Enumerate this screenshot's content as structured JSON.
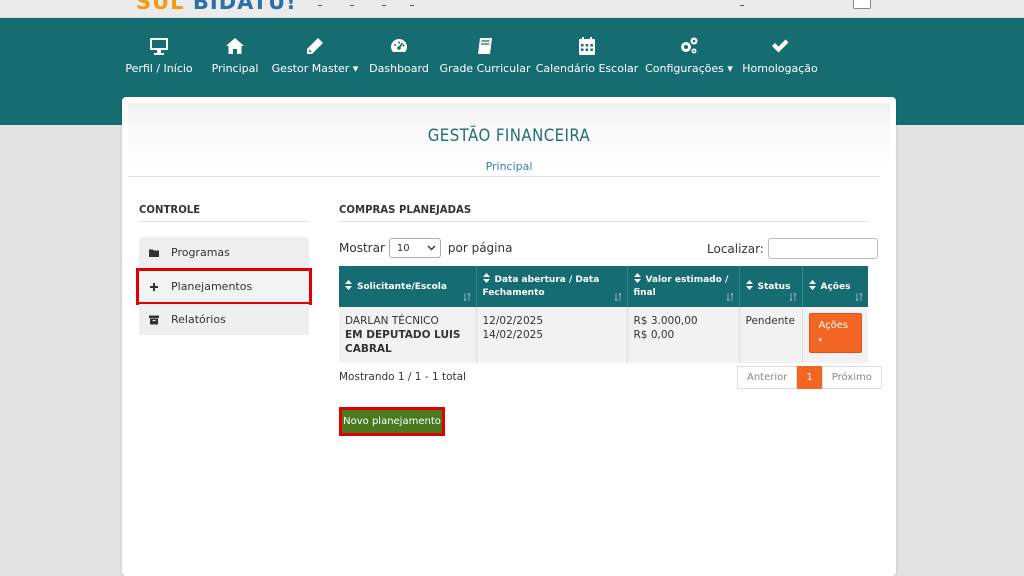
{
  "topbar": {
    "logo_text_a": "SUL",
    "logo_text_b": "BIDATU!"
  },
  "colors": {
    "primary_teal": "#156d72",
    "accent_orange": "#f26522",
    "highlight_red": "#e00000",
    "action_green": "#4a7a1f"
  },
  "nav": {
    "items": [
      {
        "label": "Perfil / Início",
        "icon": "monitor-icon"
      },
      {
        "label": "Principal",
        "icon": "home-icon"
      },
      {
        "label": "Gestor Master",
        "icon": "pencil-icon",
        "dropdown": true
      },
      {
        "label": "Dashboard",
        "icon": "gauge-icon"
      },
      {
        "label": "Grade Curricular",
        "icon": "book-icon"
      },
      {
        "label": "Calendário Escolar",
        "icon": "calendar-icon"
      },
      {
        "label": "Configurações",
        "icon": "gears-icon",
        "dropdown": true
      },
      {
        "label": "Homologação",
        "icon": "check-icon"
      }
    ]
  },
  "header": {
    "title": "GESTÃO FINANCEIRA",
    "breadcrumb": "Principal"
  },
  "sidebar": {
    "title": "CONTROLE",
    "items": [
      {
        "label": "Programas",
        "icon": "folder-icon"
      },
      {
        "label": "Planejamentos",
        "icon": "plus-icon",
        "active": true
      },
      {
        "label": "Relatórios",
        "icon": "archive-icon"
      }
    ]
  },
  "main": {
    "title": "COMPRAS PLANEJADAS",
    "show_label": "Mostrar",
    "per_page_value": "10",
    "per_page_suffix": "por página",
    "search_label": "Localizar:",
    "search_value": "",
    "table": {
      "columns": [
        "Solicitante/Escola",
        "Data abertura / Data Fechamento",
        "Valor estimado / final",
        "Status",
        "Ações"
      ],
      "rows": [
        {
          "solicitante": "DARLAN TÉCNICO",
          "escola": "EM DEPUTADO LUIS CABRAL",
          "data_abertura": "12/02/2025",
          "data_fechamento": "14/02/2025",
          "valor_estimado": "R$ 3.000,00",
          "valor_final": "R$ 0,00",
          "status": "Pendente",
          "acoes_label": "Ações"
        }
      ]
    },
    "info": "Mostrando 1 / 1 - 1 total",
    "pager": {
      "prev": "Anterior",
      "current": "1",
      "next": "Próximo"
    },
    "new_button": "Novo planejamento"
  }
}
